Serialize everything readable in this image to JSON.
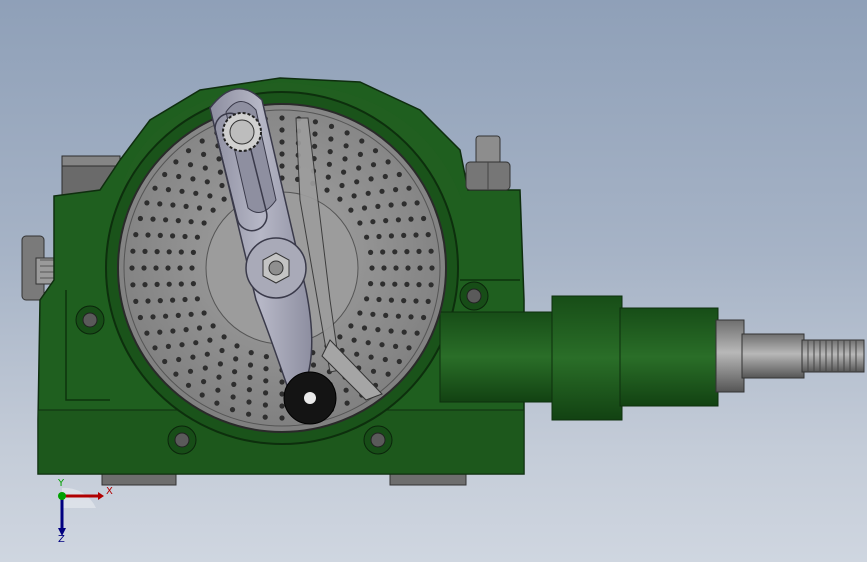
{
  "viewport": {
    "view": "front",
    "background_top": "#8fa0b8",
    "background_bottom": "#cfd6e0"
  },
  "model": {
    "body_color": "#1f5f1f",
    "body_shadow": "#0f3a10",
    "index_plate_color": "#8c8c8c",
    "crank_color": "#a8a9b8",
    "steel_color": "#8a8a8a",
    "knob_color": "#141414"
  },
  "triad": {
    "x_label": "X",
    "y_label": "Y",
    "z_label": "Z",
    "x_color": "#b00000",
    "y_color": "#00a000",
    "z_color": "#000080"
  }
}
